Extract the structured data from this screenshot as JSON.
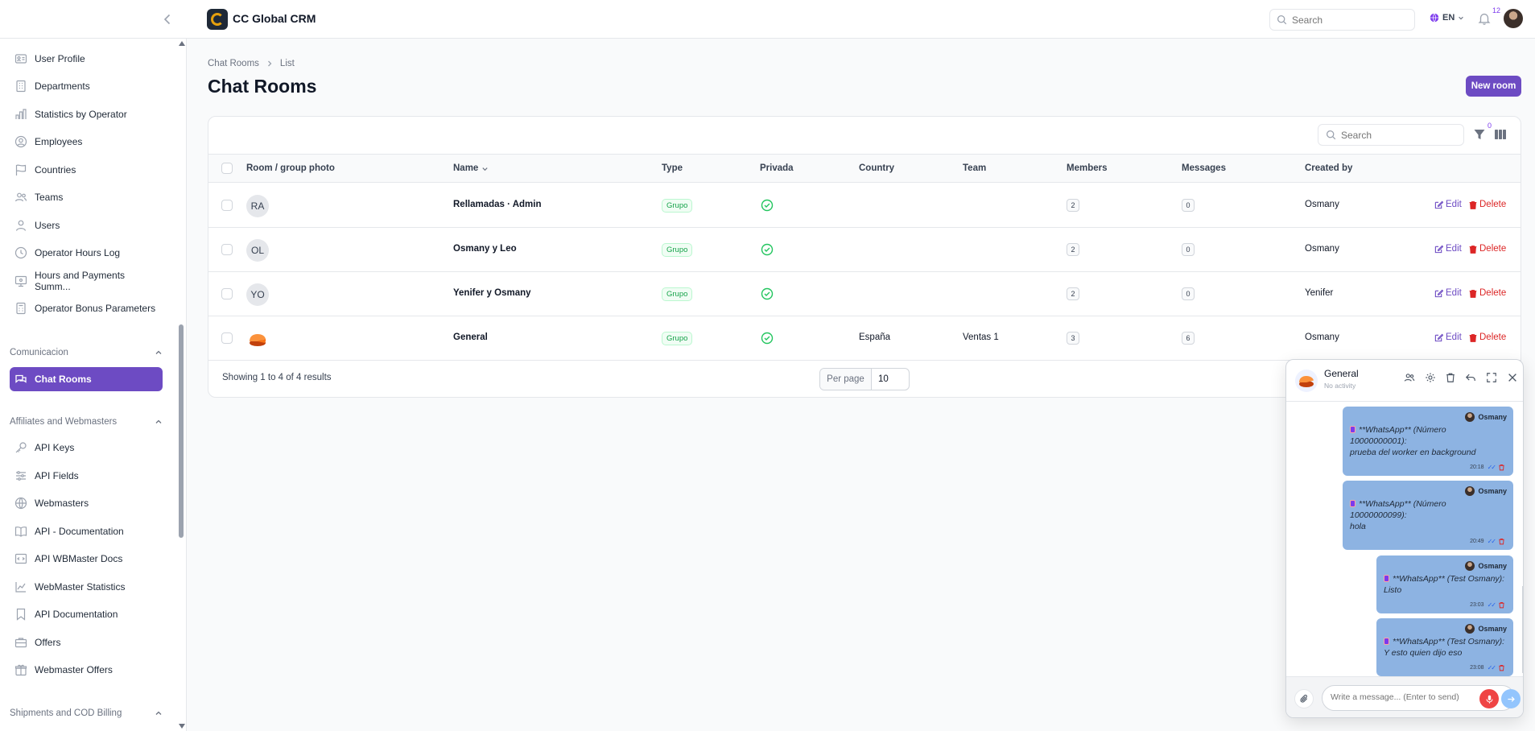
{
  "app": {
    "brand": "CC Global CRM"
  },
  "header": {
    "search_placeholder": "Search",
    "language": "EN",
    "notifications_count": "12"
  },
  "sidebar": {
    "items_top": [
      {
        "label": "User Profile",
        "icon": "id-card-icon"
      },
      {
        "label": "Departments",
        "icon": "building-icon"
      },
      {
        "label": "Statistics by Operator",
        "icon": "bar-chart-icon"
      },
      {
        "label": "Employees",
        "icon": "user-circle-icon"
      },
      {
        "label": "Countries",
        "icon": "flag-icon"
      },
      {
        "label": "Teams",
        "icon": "users-icon"
      },
      {
        "label": "Users",
        "icon": "user-icon"
      },
      {
        "label": "Operator Hours Log",
        "icon": "clock-icon"
      },
      {
        "label": "Hours and Payments Summ...",
        "icon": "monitor-icon"
      },
      {
        "label": "Operator Bonus Parameters",
        "icon": "calculator-icon"
      }
    ],
    "group_comunicacion": "Comunicacion",
    "active_item": "Chat Rooms",
    "group_affiliates": "Affiliates and Webmasters",
    "items_affiliates": [
      {
        "label": "API Keys",
        "icon": "key-icon"
      },
      {
        "label": "API Fields",
        "icon": "sliders-icon"
      },
      {
        "label": "Webmasters",
        "icon": "globe-icon"
      },
      {
        "label": "API - Documentation",
        "icon": "book-open-icon"
      },
      {
        "label": "API WBMaster Docs",
        "icon": "code-doc-icon"
      },
      {
        "label": "WebMaster Statistics",
        "icon": "line-chart-icon"
      },
      {
        "label": "API Documentation",
        "icon": "bookmark-icon"
      },
      {
        "label": "Offers",
        "icon": "briefcase-icon"
      },
      {
        "label": "Webmaster Offers",
        "icon": "gift-icon"
      }
    ],
    "group_shipments": "Shipments and COD Billing"
  },
  "breadcrumb": {
    "parent": "Chat Rooms",
    "current": "List"
  },
  "page": {
    "title": "Chat Rooms",
    "new_button": "New room"
  },
  "table": {
    "search_placeholder": "Search",
    "filter_count": "0",
    "columns": [
      "Room / group photo",
      "Name",
      "Type",
      "Privada",
      "Country",
      "Team",
      "Members",
      "Messages",
      "Created by"
    ],
    "rows": [
      {
        "initials": "RA",
        "name": "Rellamadas · Admin",
        "type": "Grupo",
        "country": "",
        "team": "",
        "members": "2",
        "messages": "0",
        "created_by": "Osmany"
      },
      {
        "initials": "OL",
        "name": "Osmany y Leo",
        "type": "Grupo",
        "country": "",
        "team": "",
        "members": "2",
        "messages": "0",
        "created_by": "Osmany"
      },
      {
        "initials": "YO",
        "name": "Yenifer y Osmany",
        "type": "Grupo",
        "country": "",
        "team": "",
        "members": "2",
        "messages": "0",
        "created_by": "Yenifer"
      },
      {
        "initials": "",
        "name": "General",
        "type": "Grupo",
        "country": "España",
        "team": "Ventas 1",
        "members": "3",
        "messages": "6",
        "created_by": "Osmany"
      }
    ],
    "edit_label": "Edit",
    "delete_label": "Delete",
    "footer": "Showing 1 to 4 of 4 results",
    "per_page_label": "Per page",
    "per_page_value": "10"
  },
  "chat": {
    "room_name": "General",
    "status": "No activity",
    "messages": [
      {
        "sender": "Osmany",
        "line1": "**WhatsApp** (Número",
        "line2": "10000000001):",
        "line3": "prueba del worker en background",
        "time": "20:18"
      },
      {
        "sender": "Osmany",
        "line1": "**WhatsApp** (Número",
        "line2": "10000000099):",
        "line3": "hola",
        "time": "20:49"
      },
      {
        "sender": "Osmany",
        "line1": "**WhatsApp** (Test Osmany):",
        "line2": "Listo",
        "time": "23:03"
      },
      {
        "sender": "Osmany",
        "line1": "**WhatsApp** (Test Osmany):",
        "line2": "Y esto quien dijo eso",
        "time": "23:08"
      }
    ],
    "input_placeholder": "Write a message... (Enter to send)"
  }
}
